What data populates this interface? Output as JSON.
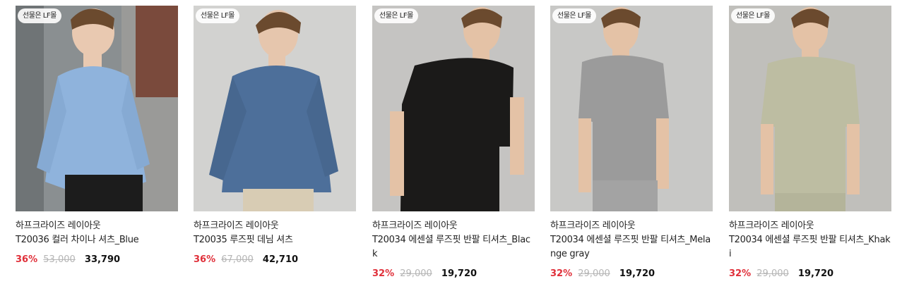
{
  "products": [
    {
      "badge": "선물은 LF몰",
      "brand": "하프크라이즈 레이아웃",
      "name": "T20036 컬러 차이나 셔츠_Blue",
      "discount": "36%",
      "original_price": "53,000",
      "sale_price": "33,790",
      "image": {
        "bg": "#7d8284",
        "garment": "#8fb3dc",
        "pants": "#1c1c1c",
        "wall": "#9a9a98"
      }
    },
    {
      "badge": "선물은 LF몰",
      "brand": "하프크라이즈 레이아웃",
      "name": "T20035 루즈핏 데님 셔츠",
      "discount": "36%",
      "original_price": "67,000",
      "sale_price": "42,710",
      "image": {
        "bg": "#cfcfcd",
        "garment": "#4d6f9a",
        "pants": "#d8ccb4",
        "wall": "#d2d2d0"
      }
    },
    {
      "badge": "선물은 LF몰",
      "brand": "하프크라이즈 레이아웃",
      "name": "T20034 에센셜 루즈핏 반팔 티셔츠_Black",
      "discount": "32%",
      "original_price": "29,000",
      "sale_price": "19,720",
      "image": {
        "bg": "#c2c2c0",
        "garment": "#1b1a19",
        "pants": "#1e1d1c",
        "wall": "#c5c4c2"
      }
    },
    {
      "badge": "선물은 LF몰",
      "brand": "하프크라이즈 레이아웃",
      "name": "T20034 에센셜 루즈핏 반팔 티셔츠_Melange gray",
      "discount": "32%",
      "original_price": "29,000",
      "sale_price": "19,720",
      "image": {
        "bg": "#c6c6c4",
        "garment": "#9b9b9b",
        "pants": "#a3a3a3",
        "wall": "#c8c8c6"
      }
    },
    {
      "badge": "선물은 LF몰",
      "brand": "하프크라이즈 레이아웃",
      "name": "T20034 에센셜 루즈핏 반팔 티셔츠_Khaki",
      "discount": "32%",
      "original_price": "29,000",
      "sale_price": "19,720",
      "image": {
        "bg": "#bdbcb8",
        "garment": "#bdbda2",
        "pants": "#b4b49a",
        "wall": "#c0bfbb"
      }
    }
  ]
}
